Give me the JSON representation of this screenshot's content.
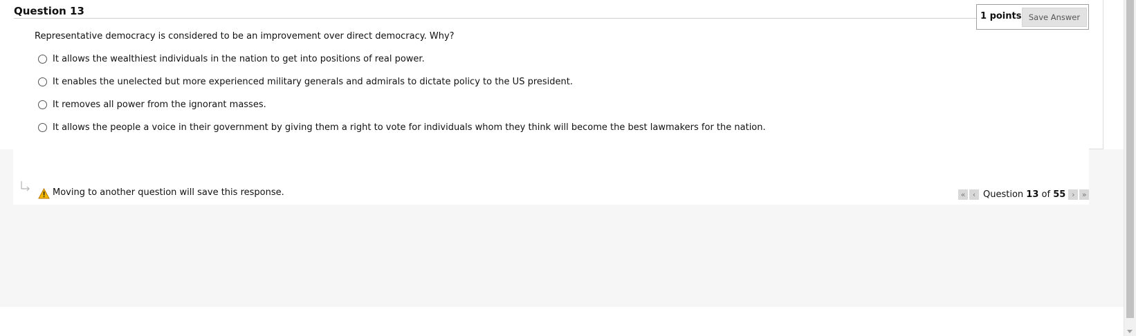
{
  "question": {
    "title": "Question 13",
    "points": "1 points",
    "save_label": "Save Answer",
    "text": "Representative democracy is considered to be an improvement over direct democracy.  Why?",
    "options": [
      "It allows the wealthiest individuals in the nation to get into positions of real power.",
      "It enables the unelected but more experienced military generals and admirals to dictate policy to the US president.",
      "It removes all power from the ignorant masses.",
      "It allows the people a voice in their government by giving them a right to vote for individuals whom they think  will become the best lawmakers for the nation."
    ]
  },
  "footer": {
    "warning": "Moving to another question will save this response.",
    "nav": {
      "prefix": "Question",
      "current": "13",
      "of": "of",
      "total": "55"
    }
  },
  "icons": {
    "warning": "warning-triangle-icon",
    "hook": "arrow-hook-icon",
    "first": "double-chevron-left-icon",
    "prev": "chevron-left-icon",
    "next": "chevron-right-icon",
    "last": "double-chevron-right-icon"
  },
  "colors": {
    "warning_fill": "#f5b800",
    "button_bg": "#e2e2e2",
    "page_gray": "#f6f6f6"
  }
}
